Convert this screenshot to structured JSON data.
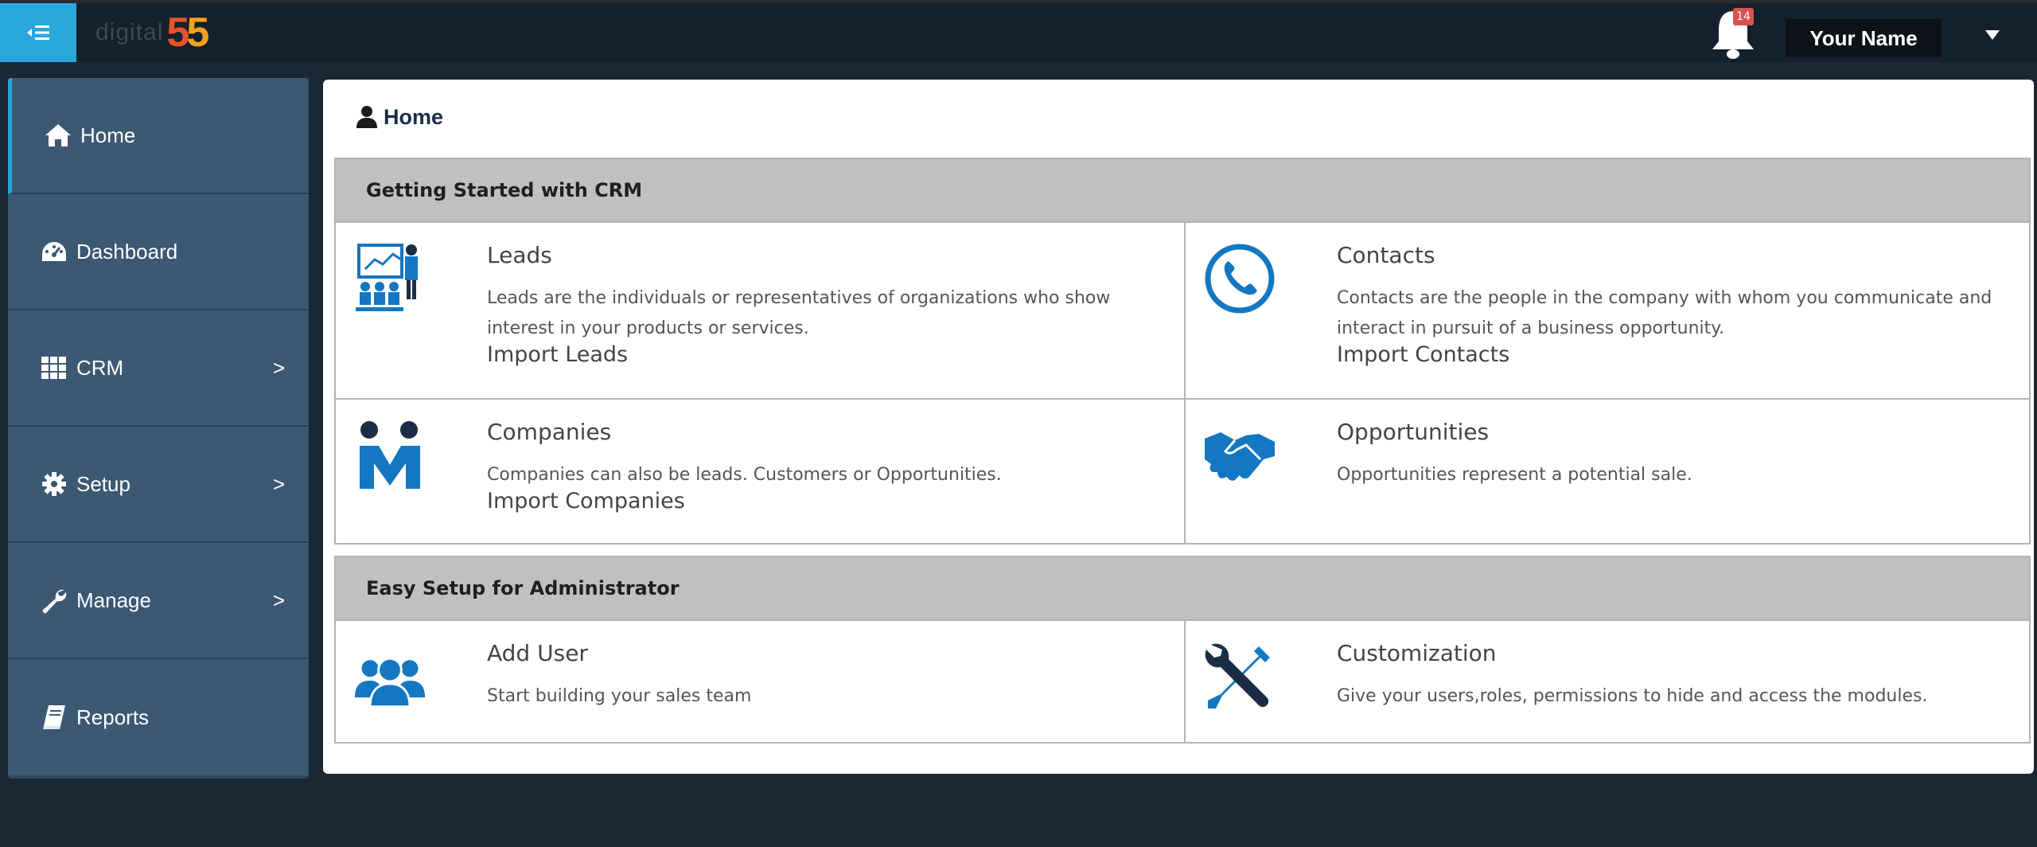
{
  "header": {
    "menu_toggle_icon": "indent-menu-icon",
    "logo_text": "digital",
    "logo_number": "55",
    "notification_icon": "bell-icon",
    "notification_count": "14",
    "user_name": "Your Name",
    "user_caret_icon": "caret-down-icon"
  },
  "sidebar": {
    "items": [
      {
        "label": "Home",
        "icon": "home-icon",
        "active": true,
        "has_children": false
      },
      {
        "label": "Dashboard",
        "icon": "dashboard-icon",
        "active": false,
        "has_children": false
      },
      {
        "label": "CRM",
        "icon": "grid-icon",
        "active": false,
        "has_children": true,
        "chevron": ">"
      },
      {
        "label": "Setup",
        "icon": "gear-icon",
        "active": false,
        "has_children": true,
        "chevron": ">"
      },
      {
        "label": "Manage",
        "icon": "wrench-icon",
        "active": false,
        "has_children": true,
        "chevron": ">"
      },
      {
        "label": "Reports",
        "icon": "book-icon",
        "active": false,
        "has_children": false
      }
    ]
  },
  "breadcrumb": {
    "icon": "user-icon",
    "label": "Home"
  },
  "sections": {
    "getting_started": {
      "title": "Getting Started with CRM",
      "cells": {
        "leads": {
          "icon": "presentation-icon",
          "title": "Leads",
          "description": "Leads are the individuals or representatives of organizations who show interest in your products or services.",
          "link": "Import Leads"
        },
        "contacts": {
          "icon": "phone-icon",
          "title": "Contacts",
          "description": "Contacts are the people in the company with whom you communicate and interact in pursuit of a business opportunity.",
          "link": "Import Contacts"
        },
        "companies": {
          "icon": "companies-icon",
          "title": "Companies",
          "description": "Companies can also be leads. Customers or Opportunities.",
          "link": "Import Companies"
        },
        "opportunities": {
          "icon": "handshake-icon",
          "title": "Opportunities",
          "description": "Opportunities represent a potential sale."
        }
      }
    },
    "easy_setup": {
      "title": "Easy Setup for Administrator",
      "cells": {
        "add_user": {
          "icon": "users-icon",
          "title": "Add User",
          "description": "Start building your sales team"
        },
        "customization": {
          "icon": "tools-icon",
          "title": "Customization",
          "description": "Give your users,roles, permissions to hide and access the modules."
        }
      }
    }
  },
  "colors": {
    "accent": "#27a7dc",
    "topbar_bg": "#14202b",
    "sidebar_bg": "#3c5873",
    "icon_blue": "#1477c1",
    "section_header_bg": "#c0c0c0"
  }
}
